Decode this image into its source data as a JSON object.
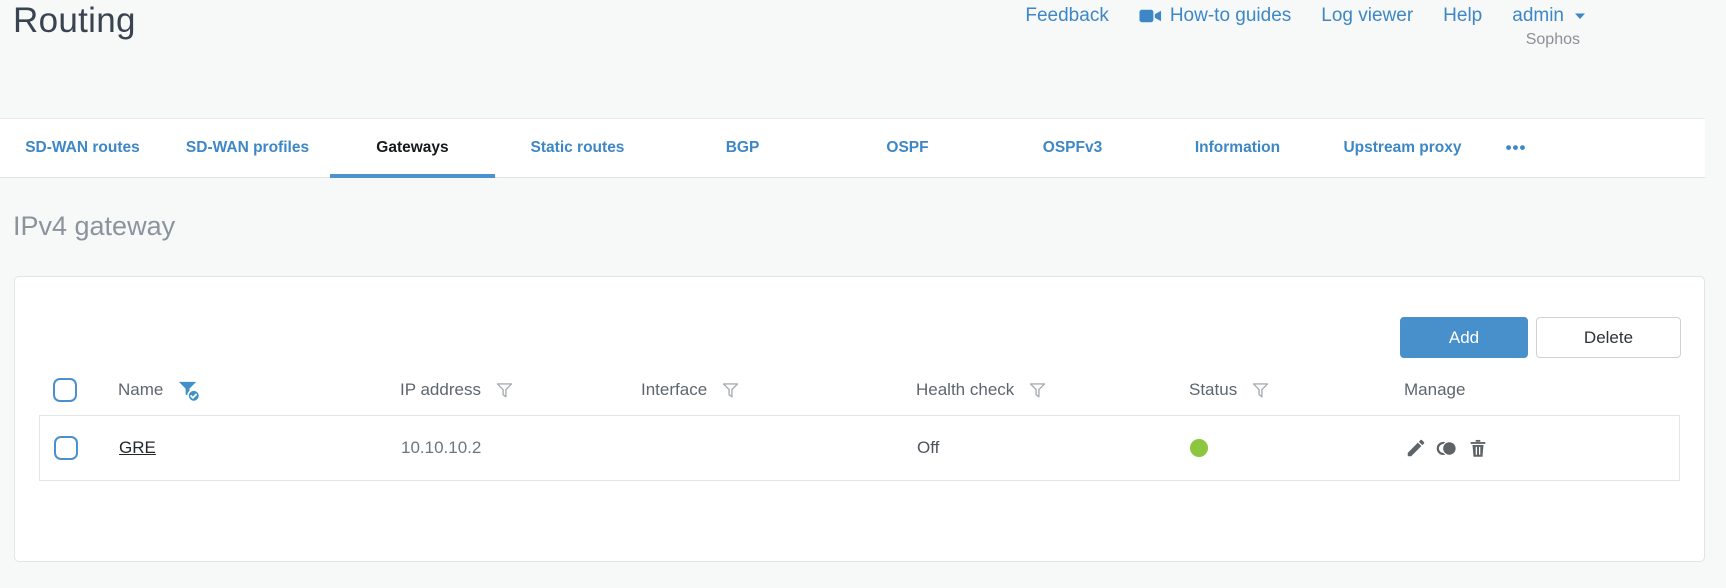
{
  "header": {
    "title": "Routing",
    "nav": {
      "feedback": "Feedback",
      "howto_guides": "How-to guides",
      "log_viewer": "Log viewer",
      "help": "Help",
      "admin": "admin"
    },
    "brand": "Sophos"
  },
  "tabs": {
    "items": [
      {
        "label": "SD-WAN routes"
      },
      {
        "label": "SD-WAN profiles"
      },
      {
        "label": "Gateways",
        "active": true
      },
      {
        "label": "Static routes"
      },
      {
        "label": "BGP"
      },
      {
        "label": "OSPF"
      },
      {
        "label": "OSPFv3"
      },
      {
        "label": "Information"
      },
      {
        "label": "Upstream proxy"
      }
    ],
    "more_label": "•••"
  },
  "section": {
    "title": "IPv4 gateway"
  },
  "toolbar": {
    "add_label": "Add",
    "delete_label": "Delete"
  },
  "table": {
    "columns": [
      {
        "label": "Name",
        "filter": "active"
      },
      {
        "label": "IP address",
        "filter": "default"
      },
      {
        "label": "Interface",
        "filter": "default"
      },
      {
        "label": "Health check",
        "filter": "default"
      },
      {
        "label": "Status",
        "filter": "default"
      },
      {
        "label": "Manage",
        "filter": "none"
      }
    ],
    "rows": [
      {
        "name": "GRE",
        "ip_address": "10.10.10.2",
        "interface": "",
        "health_check": "Off",
        "status": "green"
      }
    ]
  },
  "colors": {
    "accent_blue": "#4190ca",
    "status_green": "#8cc63f"
  }
}
